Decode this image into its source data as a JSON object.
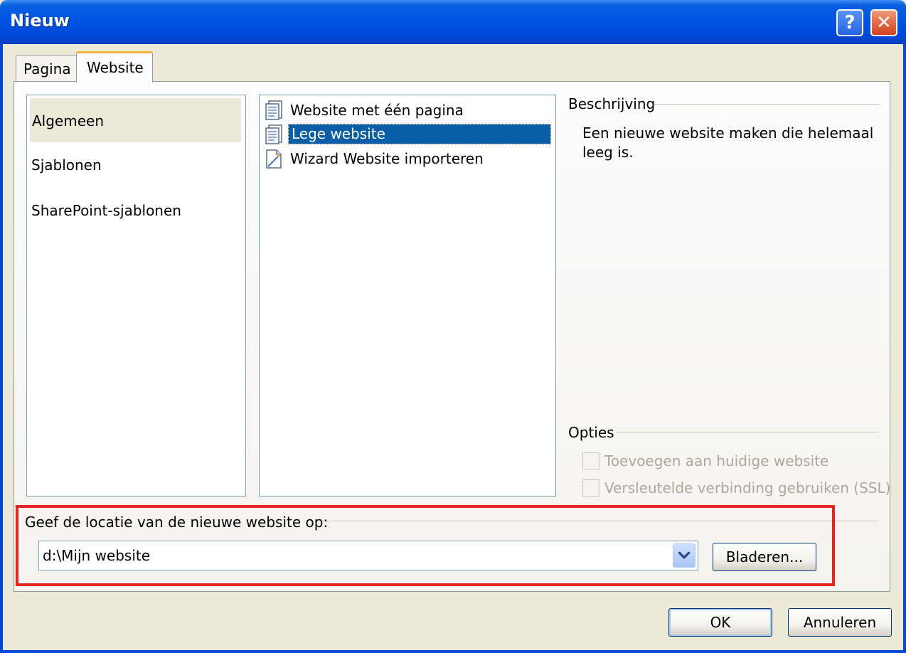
{
  "window": {
    "title": "Nieuw",
    "help_glyph": "?",
    "close_glyph": "✕"
  },
  "tabs": [
    {
      "label": "Pagina"
    },
    {
      "label": "Website"
    }
  ],
  "categories": [
    {
      "label": "Algemeen"
    },
    {
      "label": "Sjablonen"
    },
    {
      "label": "SharePoint-sjablonen"
    }
  ],
  "templates": [
    {
      "label": "Website met één pagina",
      "icon": "page-icon"
    },
    {
      "label": "Lege website",
      "icon": "page-icon"
    },
    {
      "label": "Wizard Website importeren",
      "icon": "wizard-page-icon"
    }
  ],
  "description": {
    "title": "Beschrijving",
    "text": "Een nieuwe website maken die helemaal leeg is."
  },
  "options": {
    "title": "Opties",
    "add_to_current": "Toevoegen aan huidige website",
    "use_ssl": "Versleutelde verbinding gebruiken (SSL)"
  },
  "location": {
    "label": "Geef de locatie van de nieuwe website op:",
    "value": "d:\\Mijn website",
    "browse_label": "Bladeren..."
  },
  "buttons": {
    "ok": "OK",
    "cancel": "Annuleren"
  },
  "colors": {
    "highlight": "#e8241e",
    "selection": "#0a5ea8",
    "titlebar": "#0055e5"
  }
}
